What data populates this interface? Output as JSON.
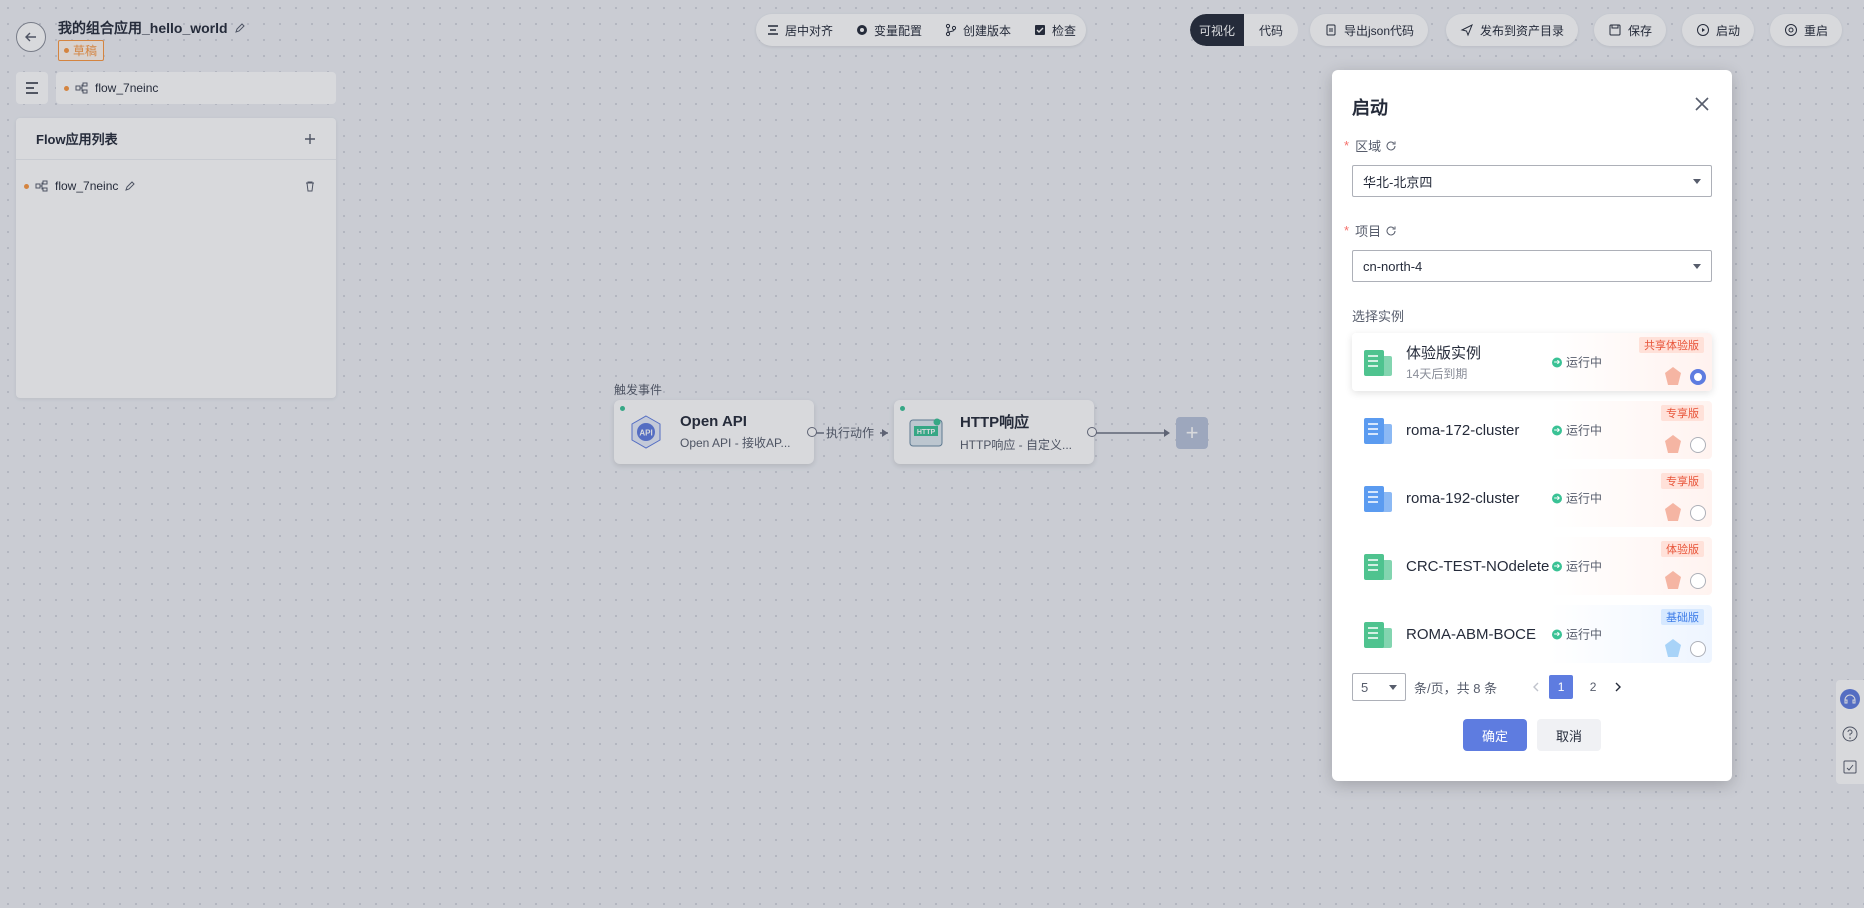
{
  "header": {
    "app_title": "我的组合应用_hello_world",
    "draft_badge": "草稿"
  },
  "toolbar": {
    "center_align": "居中对齐",
    "variables": "变量配置",
    "create_version": "创建版本",
    "check": "检查",
    "view_visual": "可视化",
    "view_code": "代码",
    "export_json": "导出json代码",
    "publish": "发布到资产目录",
    "save": "保存",
    "start": "启动",
    "restart": "重启"
  },
  "flow_tab": {
    "name": "flow_7neinc"
  },
  "flow_panel": {
    "title": "Flow应用列表",
    "items": [
      {
        "name": "flow_7neinc"
      }
    ]
  },
  "canvas": {
    "trigger_label": "触发事件",
    "edge_label": "执行动作",
    "nodes": [
      {
        "title": "Open API",
        "subtitle": "Open API - 接收AP...",
        "icon": "api-icon"
      },
      {
        "title": "HTTP响应",
        "subtitle": "HTTP响应 - 自定义...",
        "icon": "http-icon"
      }
    ]
  },
  "dialog": {
    "title": "启动",
    "region_label": "区域",
    "region_value": "华北-北京四",
    "project_label": "项目",
    "project_value": "cn-north-4",
    "instance_label": "选择实例",
    "instances": [
      {
        "name": "体验版实例",
        "expire": "14天后到期",
        "status": "运行中",
        "tag": "共享体验版",
        "theme": "warm",
        "selected": true,
        "icon_color": "#4fc38f"
      },
      {
        "name": "roma-172-cluster",
        "expire": "",
        "status": "运行中",
        "tag": "专享版",
        "theme": "warm",
        "selected": false,
        "icon_color": "#5b9bf0"
      },
      {
        "name": "roma-192-cluster",
        "expire": "",
        "status": "运行中",
        "tag": "专享版",
        "theme": "warm",
        "selected": false,
        "icon_color": "#5b9bf0"
      },
      {
        "name": "CRC-TEST-NOdelete",
        "expire": "",
        "status": "运行中",
        "tag": "体验版",
        "theme": "warm",
        "selected": false,
        "icon_color": "#4fc38f"
      },
      {
        "name": "ROMA-ABM-BOCE",
        "expire": "",
        "status": "运行中",
        "tag": "基础版",
        "theme": "cool",
        "selected": false,
        "icon_color": "#4fc38f"
      }
    ],
    "pager": {
      "page_size": "5",
      "summary": "条/页，共 8 条",
      "pages": [
        "1",
        "2"
      ],
      "current": "1"
    },
    "confirm": "确定",
    "cancel": "取消"
  },
  "colors": {
    "primary": "#5e7ce0",
    "warning": "#fa9841",
    "success": "#3ac295",
    "danger": "#f66f6a"
  }
}
